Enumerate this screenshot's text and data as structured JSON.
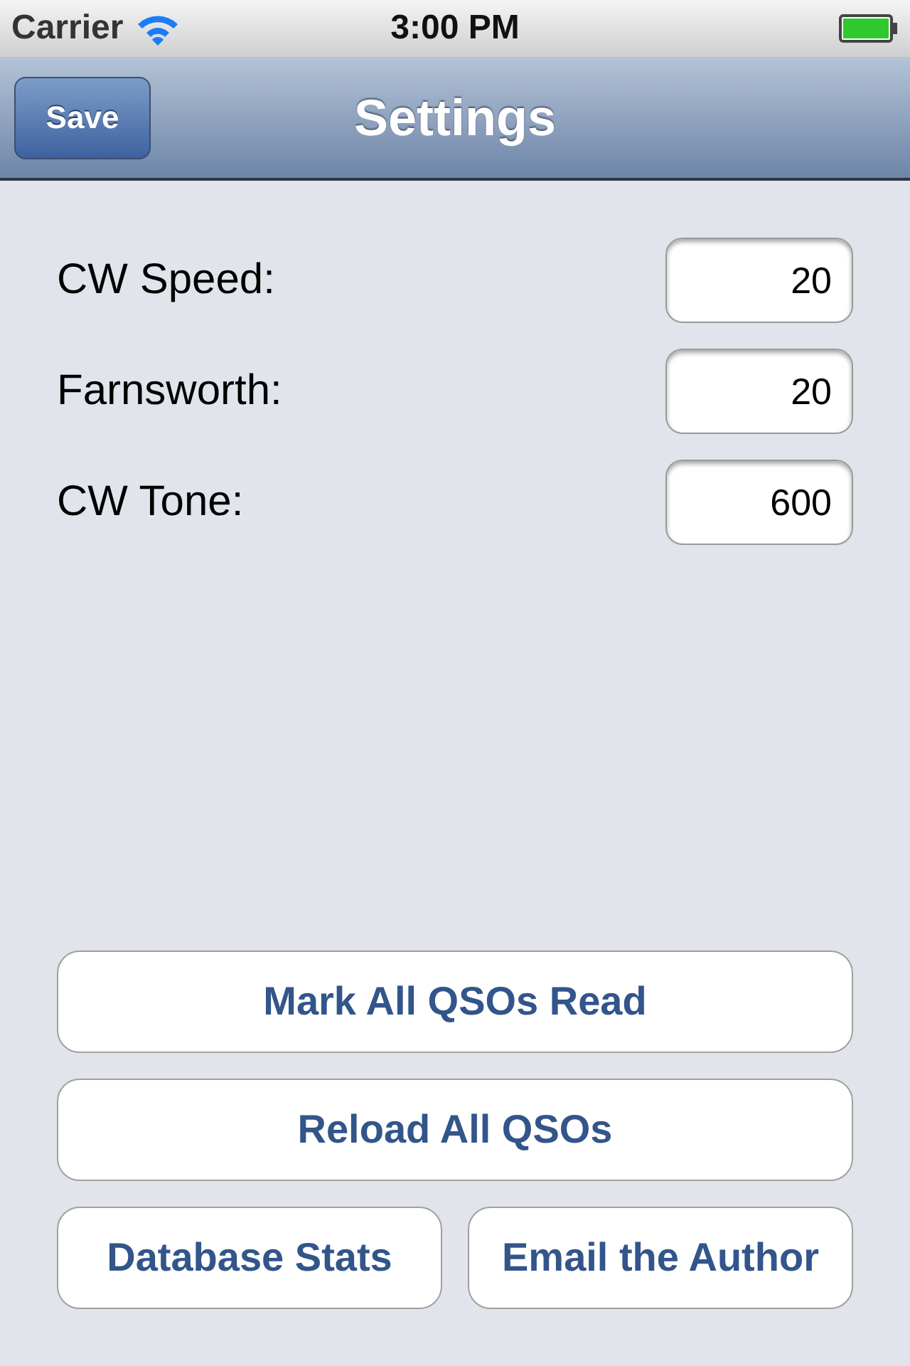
{
  "status_bar": {
    "carrier": "Carrier",
    "time": "3:00 PM"
  },
  "nav_bar": {
    "title": "Settings",
    "left_button": "Save"
  },
  "fields": [
    {
      "label": "CW Speed:",
      "value": "20"
    },
    {
      "label": "Farnsworth:",
      "value": "20"
    },
    {
      "label": "CW Tone:",
      "value": "600"
    }
  ],
  "buttons": [
    [
      "Mark All QSOs Read"
    ],
    [
      "Reload All QSOs"
    ],
    [
      "Database Stats",
      "Email the Author"
    ]
  ]
}
